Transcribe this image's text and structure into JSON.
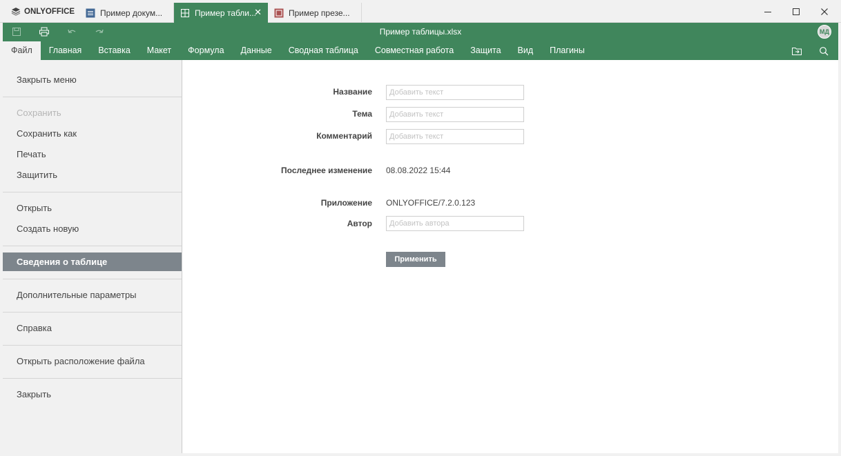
{
  "app": {
    "brand": "ONLYOFFICE"
  },
  "tabs": [
    {
      "label": "Пример докум...",
      "type": "document",
      "color": "#446995",
      "active": false
    },
    {
      "label": "Пример табли...",
      "type": "spreadsheet",
      "color": "#40865c",
      "active": true
    },
    {
      "label": "Пример презе...",
      "type": "presentation",
      "color": "#aa5252",
      "active": false
    }
  ],
  "tab_close_glyph": "✕",
  "window_controls": {
    "minimize": "minimize-icon",
    "maximize": "maximize-icon",
    "close": "close-icon"
  },
  "header": {
    "doc_title": "Пример таблицы.xlsx",
    "avatar_initials": "МД",
    "accent_color": "#40865c",
    "quick_access": [
      "save-icon",
      "print-icon",
      "undo-icon",
      "redo-icon"
    ]
  },
  "menu_tabs": [
    "Файл",
    "Главная",
    "Вставка",
    "Макет",
    "Формула",
    "Данные",
    "Сводная таблица",
    "Совместная работа",
    "Защита",
    "Вид",
    "Плагины"
  ],
  "header_icons": [
    "open-file-location-icon",
    "search-icon"
  ],
  "file_menu": {
    "items": [
      {
        "label": "Закрыть меню",
        "state": "normal"
      },
      {
        "label": "Сохранить",
        "state": "disabled"
      },
      {
        "label": "Сохранить как",
        "state": "normal"
      },
      {
        "label": "Печать",
        "state": "normal"
      },
      {
        "label": "Защитить",
        "state": "normal"
      },
      {
        "label": "Открыть",
        "state": "normal"
      },
      {
        "label": "Создать новую",
        "state": "normal"
      },
      {
        "label": "Сведения о таблице",
        "state": "active"
      },
      {
        "label": "Дополнительные параметры",
        "state": "normal"
      },
      {
        "label": "Справка",
        "state": "normal"
      },
      {
        "label": "Открыть расположение файла",
        "state": "normal"
      },
      {
        "label": "Закрыть",
        "state": "normal"
      }
    ]
  },
  "info": {
    "title_label": "Название",
    "title_placeholder": "Добавить текст",
    "subject_label": "Тема",
    "subject_placeholder": "Добавить текст",
    "comment_label": "Комментарий",
    "comment_placeholder": "Добавить текст",
    "modified_label": "Последнее изменение",
    "modified_value": "08.08.2022 15:44",
    "app_label": "Приложение",
    "app_value": "ONLYOFFICE/7.2.0.123",
    "author_label": "Автор",
    "author_placeholder": "Добавить автора",
    "apply_label": "Применить"
  }
}
